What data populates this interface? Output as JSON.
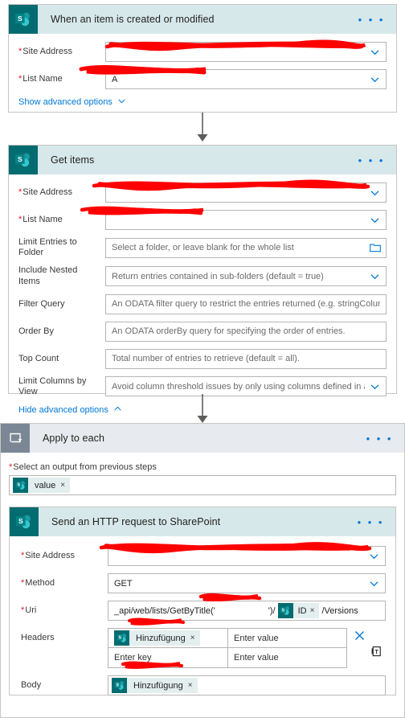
{
  "flow": {
    "steps": [
      {
        "id": "trigger",
        "icon": "sharepoint-icon",
        "title": "When an item is created or modified",
        "menu": "• • •",
        "fields": [
          {
            "label": "Site Address",
            "required": true,
            "value": "",
            "placeholder": "",
            "control": "dropdown",
            "redacted": true
          },
          {
            "label": "List Name",
            "required": true,
            "value": "A",
            "placeholder": "",
            "control": "dropdown",
            "redacted": true
          }
        ],
        "advanced_link": "Show advanced options"
      },
      {
        "id": "get-items",
        "icon": "sharepoint-icon",
        "title": "Get items",
        "menu": "• • •",
        "fields": [
          {
            "label": "Site Address",
            "required": true,
            "value": "",
            "placeholder": "",
            "control": "dropdown",
            "redacted": true
          },
          {
            "label": "List Name",
            "required": true,
            "value": "",
            "placeholder": "",
            "control": "dropdown",
            "redacted": true
          },
          {
            "label": "Limit Entries to Folder",
            "required": false,
            "value": "",
            "placeholder": "Select a folder, or leave blank for the whole list",
            "control": "folder"
          },
          {
            "label": "Include Nested Items",
            "required": false,
            "value": "",
            "placeholder": "Return entries contained in sub-folders (default = true)",
            "control": "dropdown"
          },
          {
            "label": "Filter Query",
            "required": false,
            "value": "",
            "placeholder": "An ODATA filter query to restrict the entries returned (e.g. stringColumn eq 'stri",
            "control": "text"
          },
          {
            "label": "Order By",
            "required": false,
            "value": "",
            "placeholder": "An ODATA orderBy query for specifying the order of entries.",
            "control": "text"
          },
          {
            "label": "Top Count",
            "required": false,
            "value": "",
            "placeholder": "Total number of entries to retrieve (default = all).",
            "control": "text"
          },
          {
            "label": "Limit Columns by View",
            "required": false,
            "value": "",
            "placeholder": "Avoid column threshold issues by only using columns defined in a view",
            "control": "dropdown"
          }
        ],
        "advanced_link": "Hide advanced options"
      }
    ],
    "loop": {
      "id": "apply-to-each",
      "icon": "loop-icon",
      "title": "Apply to each",
      "menu": "• • •",
      "select_label": "Select an output from previous steps",
      "select_required": true,
      "selected_token": {
        "label": "value",
        "remove": "×",
        "icon": "sharepoint-icon"
      },
      "nested_step": {
        "id": "send-http-request",
        "icon": "sharepoint-icon",
        "title": "Send an HTTP request to SharePoint",
        "menu": "• • •",
        "fields": [
          {
            "label": "Site Address",
            "required": true,
            "value": "",
            "placeholder": "",
            "control": "dropdown",
            "redacted": true
          },
          {
            "label": "Method",
            "required": true,
            "value": "GET",
            "placeholder": "",
            "control": "dropdown"
          }
        ],
        "uri": {
          "label": "Uri",
          "required": true,
          "prefix": "_api/web/lists/GetByTitle('",
          "redacted_middle": "",
          "suffix": "')/",
          "token": {
            "label": "ID",
            "remove": "×",
            "icon": "sharepoint-icon"
          },
          "tail": "/Versions"
        },
        "headers": {
          "label": "Headers",
          "rows": [
            {
              "key_token": {
                "label": "Hinzufügung",
                "remove": "×",
                "icon": "sharepoint-icon",
                "redacted": true
              },
              "key_placeholder": "",
              "value_placeholder": "Enter value"
            },
            {
              "key_token": null,
              "key_placeholder": "Enter key",
              "value_placeholder": "Enter value"
            }
          ],
          "delete_icon": "close-icon",
          "paste_icon": "paste-text-icon"
        },
        "body": {
          "label": "Body",
          "token": {
            "label": "Hinzufügung",
            "remove": "×",
            "icon": "sharepoint-icon",
            "redacted": true
          }
        }
      }
    }
  },
  "colors": {
    "sharepoint_teal": "#036c70",
    "card_header_bg": "#d7e8ea",
    "loop_header_bg": "#e7eaee",
    "loop_icon_bg": "#7b8794",
    "accent_blue": "#0078d4",
    "required_red": "#e81123",
    "redaction_red": "#ff0000",
    "border_gray": "#c8c6c4"
  }
}
